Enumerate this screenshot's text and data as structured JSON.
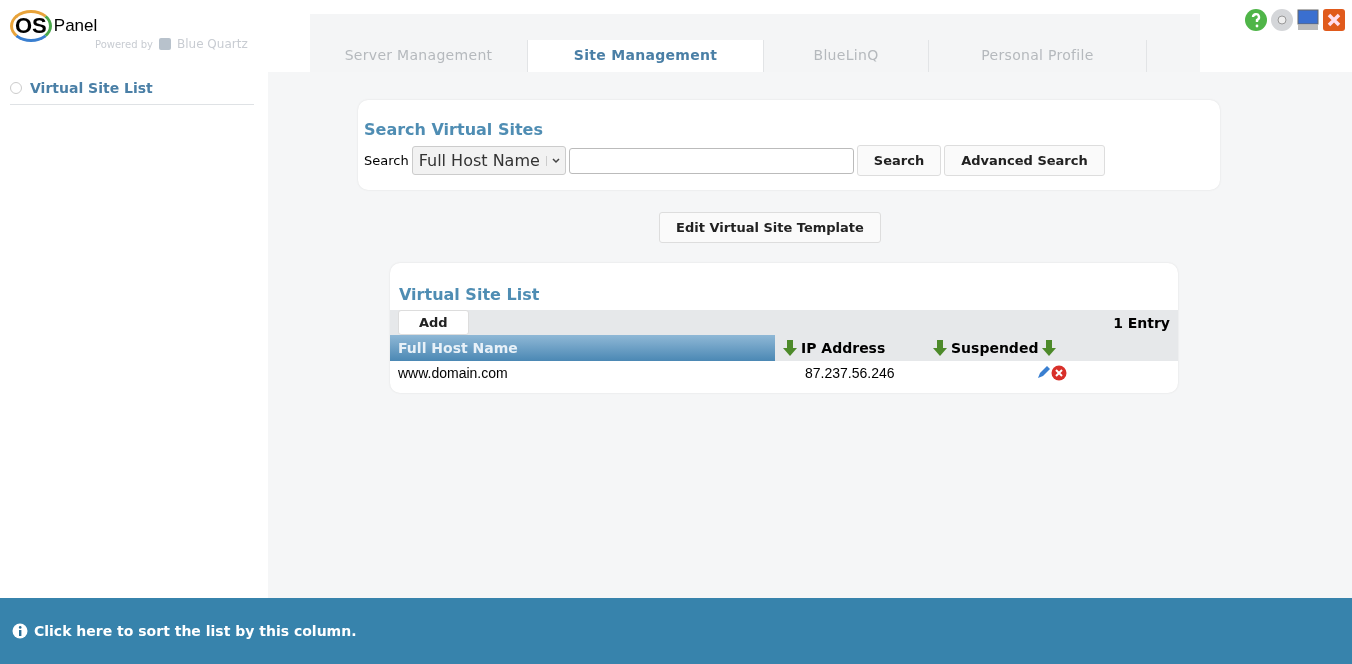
{
  "logo": {
    "brand": "OS",
    "product": "Panel",
    "powered_by": "Powered by",
    "vendor": "Blue Quartz"
  },
  "tabs": [
    {
      "label": "Server Management",
      "selected": false
    },
    {
      "label": "Site Management",
      "selected": true
    },
    {
      "label": "BlueLinQ",
      "selected": false
    },
    {
      "label": "Personal Profile",
      "selected": false
    }
  ],
  "sidebar": {
    "items": [
      {
        "label": "Virtual Site List",
        "selected": false
      }
    ]
  },
  "search_panel": {
    "title": "Search Virtual Sites",
    "label": "Search",
    "field_select": "Full Host Name",
    "buttons": [
      "Search",
      "Advanced Search"
    ]
  },
  "template_button": "Edit Virtual Site Template",
  "list": {
    "title": "Virtual Site List",
    "add_button": "Add",
    "count": "1 Entry",
    "columns": [
      {
        "label": "Full Host Name",
        "selected": true
      },
      {
        "label": "IP Address",
        "selected": false
      },
      {
        "label": "Suspended",
        "selected": false
      }
    ],
    "rows": [
      {
        "host": "www.domain.com",
        "ip": "87.237.56.246"
      }
    ]
  },
  "status_bar": {
    "text": "Click here to sort the list by this column."
  }
}
